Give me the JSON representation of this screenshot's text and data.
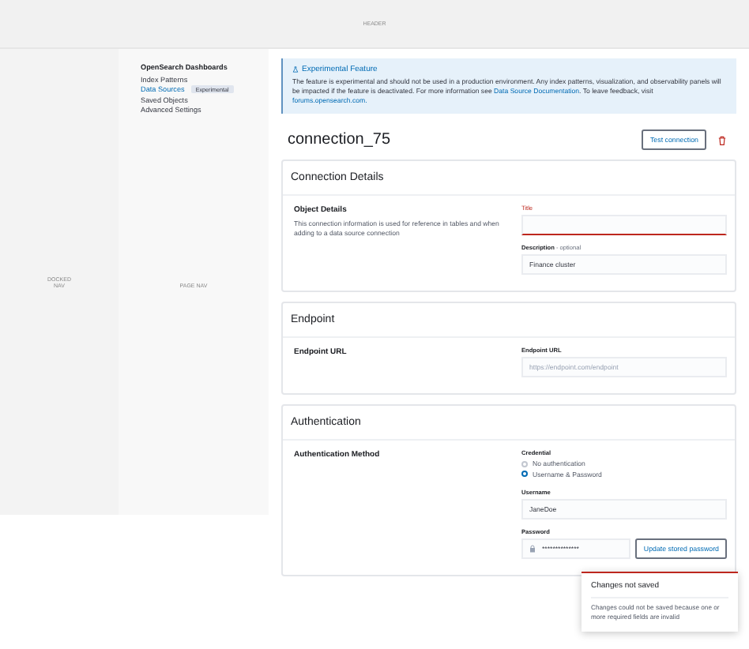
{
  "header": {
    "label": "HEADER"
  },
  "docked_nav": {
    "label": "DOCKED NAV"
  },
  "page_nav": {
    "label": "PAGE NAV",
    "title": "OpenSearch Dashboards",
    "items": [
      {
        "label": "Index Patterns",
        "selected": false
      },
      {
        "label": "Data Sources",
        "selected": true,
        "badge": "Experimental"
      },
      {
        "label": "Saved Objects",
        "selected": false
      },
      {
        "label": "Advanced Settings",
        "selected": false
      }
    ]
  },
  "callout": {
    "title": "Experimental Feature",
    "segments": [
      {
        "text": "The feature is experimental and should not be used in a production environment. Any index patterns, visualization, and observability panels will be impacted if the feature is deactivated. For more information see ",
        "link": false
      },
      {
        "text": "Data Source Documentation",
        "link": true
      },
      {
        "text": ". To leave feedback, visit ",
        "link": false
      },
      {
        "text": "forums.opensearch.com.",
        "link": true
      }
    ]
  },
  "page_title": "connection_75",
  "test_button": "Test connection",
  "sections": [
    {
      "title": "Connection Details",
      "group_title": "Object Details",
      "description": "This connection information is used for reference in tables and when adding to a data source connection",
      "fields": [
        {
          "kind": "text",
          "label": "Title",
          "invalid": true
        },
        {
          "kind": "text",
          "label": "Description",
          "optional": "- optional",
          "value": "Finance cluster",
          "invalid": false
        }
      ]
    },
    {
      "title": "Endpoint",
      "group_title": "Endpoint URL",
      "fields": [
        {
          "kind": "text",
          "label": "Endpoint URL",
          "placeholder": "https://endpoint.com/endpoint",
          "invalid": false
        }
      ]
    },
    {
      "title": "Authentication",
      "group_title": "Authentication Method",
      "fields": [
        {
          "kind": "radio",
          "label": "Credential",
          "options": [
            {
              "label": "No authentication",
              "selected": false
            },
            {
              "label": "Username & Password",
              "selected": true
            }
          ]
        },
        {
          "kind": "text",
          "label": "Username",
          "value": "JaneDoe",
          "invalid": false
        },
        {
          "kind": "password",
          "label": "Password",
          "value": "**************",
          "button": "Update stored password"
        }
      ]
    }
  ],
  "toast": {
    "title": "Changes not saved",
    "text": "Changes could not be saved because one or more required fields are invalid"
  }
}
